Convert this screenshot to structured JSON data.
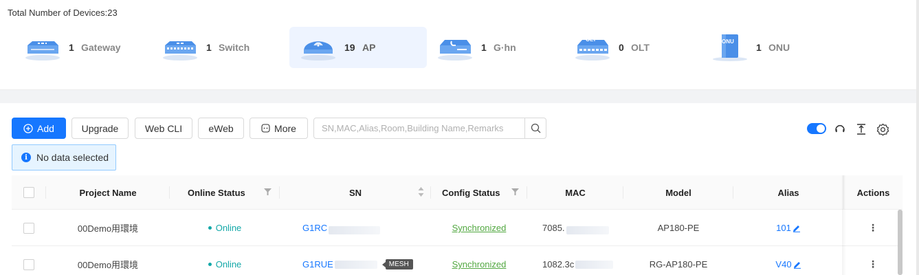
{
  "summary": {
    "total_label": "Total Number of Devices:",
    "total_count": "23",
    "devices": [
      {
        "name": "gateway",
        "count": "1",
        "label": "Gateway",
        "icon": "gateway-icon",
        "icon_text": ""
      },
      {
        "name": "switch",
        "count": "1",
        "label": "Switch",
        "icon": "switch-icon",
        "icon_text": ""
      },
      {
        "name": "ap",
        "count": "19",
        "label": "AP",
        "icon": "ap-icon",
        "icon_text": "",
        "active": true
      },
      {
        "name": "ghn",
        "count": "1",
        "label": "G·hn",
        "icon": "ghn-icon",
        "icon_text": ""
      },
      {
        "name": "olt",
        "count": "0",
        "label": "OLT",
        "icon": "olt-icon",
        "icon_text": "OLT"
      },
      {
        "name": "onu",
        "count": "1",
        "label": "ONU",
        "icon": "onu-icon",
        "icon_text": "ONU"
      }
    ]
  },
  "toolbar": {
    "add_label": "Add",
    "upgrade_label": "Upgrade",
    "webcli_label": "Web CLI",
    "eweb_label": "eWeb",
    "more_label": "More",
    "search_placeholder": "SN,MAC,Alias,Room,Building Name,Remarks",
    "search_value": "",
    "toggle_on": true
  },
  "selection_alert": "No data selected",
  "table": {
    "columns": [
      "Project Name",
      "Online Status",
      "SN",
      "Config Status",
      "MAC",
      "Model",
      "Alias",
      "Actions"
    ],
    "rows": [
      {
        "project": "00Demo用環境",
        "status": "Online",
        "sn": "G1RC",
        "mesh": "",
        "config": "Synchronized",
        "mac": "7085.",
        "model": "AP180-PE",
        "alias": "101",
        "actions": "⋮"
      },
      {
        "project": "00Demo用環境",
        "status": "Online",
        "sn": "G1RUE",
        "mesh": "MESH",
        "config": "Synchronized",
        "mac": "1082.3c",
        "model": "RG-AP180-PE",
        "alias": "V40",
        "actions": "⋮"
      }
    ]
  },
  "colors": {
    "primary": "#1677ff",
    "online": "#13a8a8",
    "synced": "#52a841",
    "active_card": "#eef4ff"
  }
}
